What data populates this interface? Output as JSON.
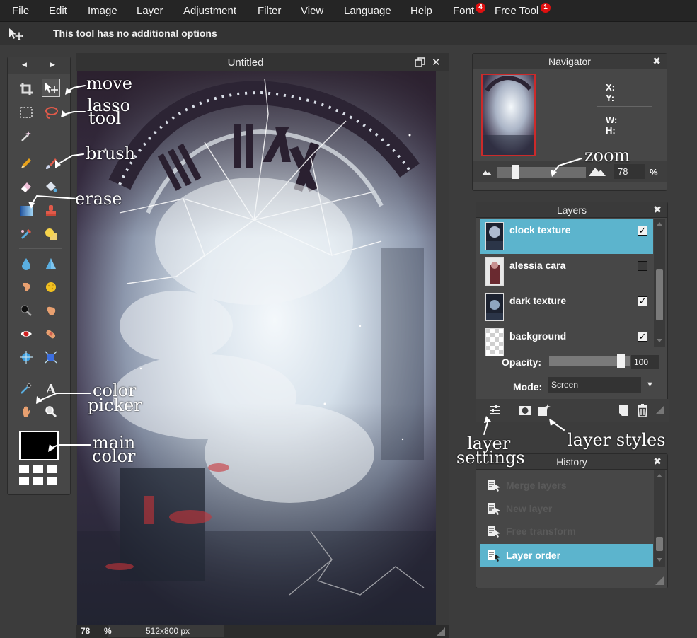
{
  "menubar": {
    "items": [
      "File",
      "Edit",
      "Image",
      "Layer",
      "Adjustment",
      "Filter",
      "View",
      "Language",
      "Help",
      "Font",
      "Free Tool"
    ],
    "font_badge": "4",
    "free_tool_badge": "1"
  },
  "options": {
    "text": "This tool has no additional options"
  },
  "canvas": {
    "title": "Untitled",
    "zoom": "78",
    "zoom_unit": "%",
    "dimensions": "512x800 px"
  },
  "navigator": {
    "title": "Navigator",
    "x_label": "X:",
    "y_label": "Y:",
    "w_label": "W:",
    "h_label": "H:",
    "zoom_value": "78",
    "zoom_unit": "%",
    "zoom_slider_fraction": 0.17
  },
  "layers": {
    "title": "Layers",
    "items": [
      {
        "name": "clock texture",
        "visible": true,
        "selected": true
      },
      {
        "name": "alessia cara",
        "visible": false,
        "selected": false
      },
      {
        "name": "dark texture",
        "visible": true,
        "selected": false
      },
      {
        "name": "background",
        "visible": true,
        "selected": false
      }
    ],
    "opacity_label": "Opacity:",
    "opacity_value": "100",
    "mode_label": "Mode:",
    "mode_value": "Screen"
  },
  "history": {
    "title": "History",
    "items": [
      {
        "name": "Merge layers",
        "active": false
      },
      {
        "name": "New layer",
        "active": false
      },
      {
        "name": "Free transform",
        "active": false
      },
      {
        "name": "Layer order",
        "active": true
      }
    ]
  },
  "annotations": {
    "move": "move",
    "lasso_1": "lasso",
    "lasso_2": "tool",
    "brush": "brush",
    "erase": "erase",
    "color_picker_1": "color",
    "color_picker_2": "picker",
    "main_color_1": "main",
    "main_color_2": "color",
    "zoom": "zoom",
    "layer_settings_1": "layer",
    "layer_settings_2": "settings",
    "layer_styles": "layer styles"
  },
  "colors": {
    "accent_selected": "#5cb4cd",
    "badge": "#e01010",
    "main_color": "#000000"
  }
}
